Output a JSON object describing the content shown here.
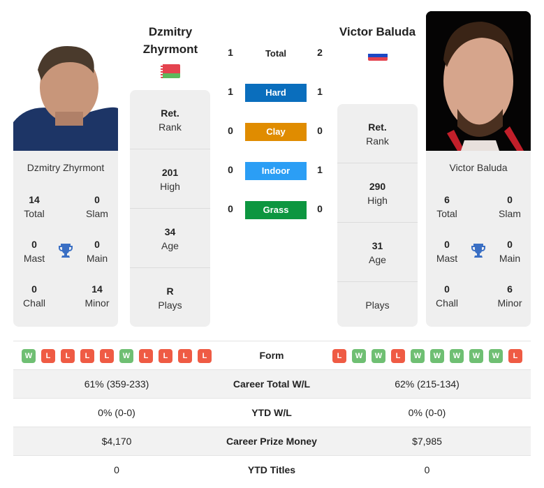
{
  "left_player": {
    "name_line1": "Dzmitry",
    "name_line2": "Zhyrmont",
    "full_name": "Dzmitry Zhyrmont",
    "country_flag": "belarus-flag",
    "info": {
      "rank": {
        "value": "Ret.",
        "label": "Rank"
      },
      "high": {
        "value": "201",
        "label": "High"
      },
      "age": {
        "value": "34",
        "label": "Age"
      },
      "plays": {
        "value": "R",
        "label": "Plays"
      }
    },
    "titles": {
      "total": {
        "value": "14",
        "label": "Total"
      },
      "slam": {
        "value": "0",
        "label": "Slam"
      },
      "mast": {
        "value": "0",
        "label": "Mast"
      },
      "main": {
        "value": "0",
        "label": "Main"
      },
      "chall": {
        "value": "0",
        "label": "Chall"
      },
      "minor": {
        "value": "14",
        "label": "Minor"
      }
    },
    "form": [
      "W",
      "L",
      "L",
      "L",
      "L",
      "W",
      "L",
      "L",
      "L",
      "L"
    ]
  },
  "right_player": {
    "name": "Victor Baluda",
    "full_name": "Victor Baluda",
    "country_flag": "russia-flag",
    "info": {
      "rank": {
        "value": "Ret.",
        "label": "Rank"
      },
      "high": {
        "value": "290",
        "label": "High"
      },
      "age": {
        "value": "31",
        "label": "Age"
      },
      "plays": {
        "value": "",
        "label": "Plays"
      }
    },
    "titles": {
      "total": {
        "value": "6",
        "label": "Total"
      },
      "slam": {
        "value": "0",
        "label": "Slam"
      },
      "mast": {
        "value": "0",
        "label": "Mast"
      },
      "main": {
        "value": "0",
        "label": "Main"
      },
      "chall": {
        "value": "0",
        "label": "Chall"
      },
      "minor": {
        "value": "6",
        "label": "Minor"
      }
    },
    "form": [
      "L",
      "W",
      "W",
      "L",
      "W",
      "W",
      "W",
      "W",
      "W",
      "L"
    ]
  },
  "h2h": {
    "total": {
      "label": "Total",
      "left": "1",
      "right": "2"
    },
    "surfaces": [
      {
        "label": "Hard",
        "left": "1",
        "right": "1",
        "color": "#0a6ebd"
      },
      {
        "label": "Clay",
        "left": "0",
        "right": "0",
        "color": "#e08c00"
      },
      {
        "label": "Indoor",
        "left": "0",
        "right": "1",
        "color": "#2b9ef5"
      },
      {
        "label": "Grass",
        "left": "0",
        "right": "0",
        "color": "#0d9640"
      }
    ]
  },
  "comparison": {
    "form_label": "Form",
    "rows": [
      {
        "label": "Career Total W/L",
        "left": "61% (359-233)",
        "right": "62% (215-134)"
      },
      {
        "label": "YTD W/L",
        "left": "0% (0-0)",
        "right": "0% (0-0)"
      },
      {
        "label": "Career Prize Money",
        "left": "$4,170",
        "right": "$7,985"
      },
      {
        "label": "YTD Titles",
        "left": "0",
        "right": "0"
      }
    ]
  },
  "colors": {
    "win": "#6fbf73",
    "loss": "#ef5b44",
    "trophy": "#3a6fc4",
    "card_bg": "#efefef"
  }
}
